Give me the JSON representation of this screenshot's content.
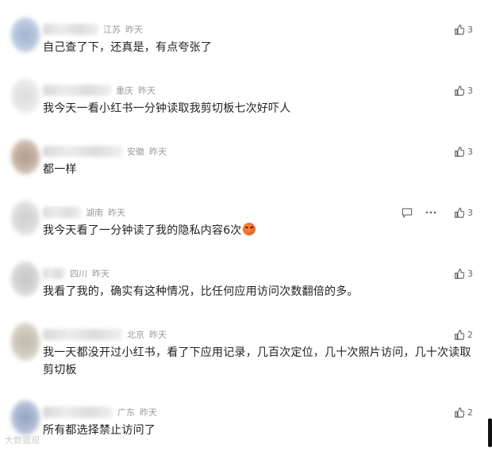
{
  "comments": [
    {
      "region": "江苏",
      "time": "昨天",
      "text": "自己查了下，还真是，有点夸张了",
      "likes": "3",
      "avatar_colors": [
        "#8fa7c9",
        "#c8d4e6"
      ]
    },
    {
      "region": "重庆",
      "time": "昨天",
      "text": "我今天一看小红书一分钟读取我剪切板七次好吓人",
      "likes": "3",
      "avatar_colors": [
        "#d8d8d8",
        "#eeeeee"
      ]
    },
    {
      "region": "安徽",
      "time": "昨天",
      "text": "都一样",
      "likes": "3",
      "avatar_colors": [
        "#a58a78",
        "#d7c6b8"
      ]
    },
    {
      "region": "湖南",
      "time": "昨天",
      "text": "我今天看了一分钟读了我的隐私内容6次",
      "likes": "3",
      "avatar_colors": [
        "#c6c6c6",
        "#e6e6e6"
      ]
    },
    {
      "region": "四川",
      "time": "昨天",
      "text": "我看了我的，确实有这种情况，比任何应用访问次数翻倍的多。",
      "likes": "3",
      "avatar_colors": [
        "#bdbdbd",
        "#dedede"
      ]
    },
    {
      "region": "北京",
      "time": "昨天",
      "text": "我一天都没开过小红书，看了下应用记录，几百次定位，几十次照片访问，几十次读取剪切板",
      "likes": "2",
      "avatar_colors": [
        "#b3ad9d",
        "#dcd8cc"
      ]
    },
    {
      "region": "广东",
      "time": "昨天",
      "text": "所有都选择禁止访问了",
      "likes": "2",
      "avatar_colors": [
        "#7f93b8",
        "#c4cde0"
      ]
    }
  ],
  "icons": {
    "like": "thumbs-up-icon",
    "reply": "comment-icon",
    "more": "more-dots-icon",
    "emoji": "angry-face-emoji"
  },
  "watermark": "大数据观"
}
